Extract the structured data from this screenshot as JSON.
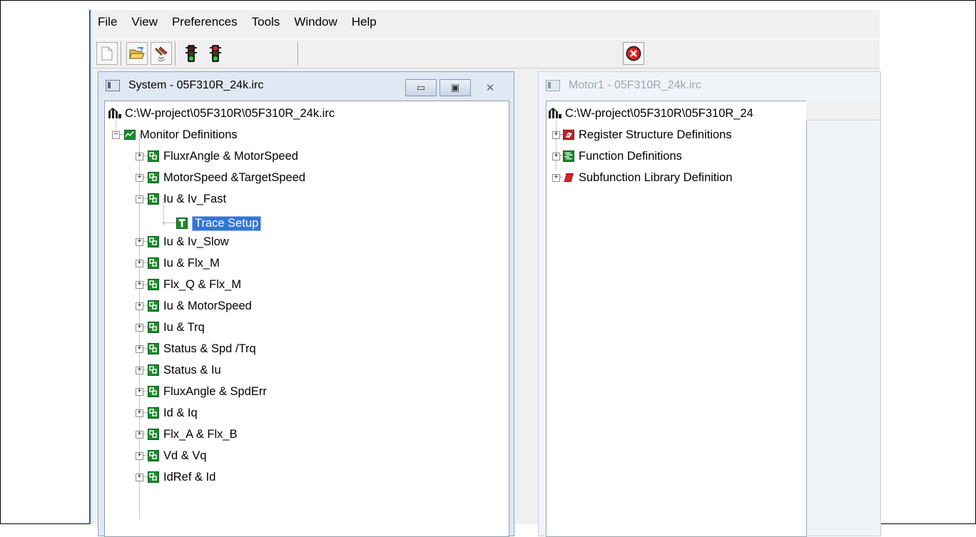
{
  "menu": [
    "File",
    "View",
    "Preferences",
    "Tools",
    "Window",
    "Help"
  ],
  "toolbar": {
    "icons": [
      "new-file-icon",
      "open-folder-icon",
      "connect-tool-icon",
      "traffic-light-green-icon",
      "traffic-light-red-icon",
      "stop-icon"
    ]
  },
  "system_window": {
    "title": "System  - 05F310R_24k.irc",
    "controls": {
      "minimize": "▭",
      "restore": "▣",
      "close": "✕"
    },
    "root_path": "C:\\W-project\\05F310R\\05F310R_24k.irc",
    "monitor_label": "Monitor Definitions",
    "items": [
      "FluxrAngle & MotorSpeed",
      "MotorSpeed &TargetSpeed",
      "Iu & Iv_Fast",
      "Iu & Iv_Slow",
      "Iu & Flx_M",
      "Flx_Q & Flx_M",
      "Iu & MotorSpeed",
      "Iu & Trq",
      "Status & Spd /Trq",
      "Status & Iu",
      "FluxAngle & SpdErr",
      "Id & Iq",
      "Flx_A & Flx_B",
      "Vd & Vq",
      "IdRef & Id"
    ],
    "trace_setup": "Trace Setup"
  },
  "motor_window": {
    "title": "Motor1  - 05F310R_24k.irc",
    "root_path": "C:\\W-project\\05F310R\\05F310R_24",
    "items": [
      "Register Structure Definitions",
      "Function Definitions",
      "Subfunction Library Definition"
    ]
  },
  "colors": {
    "accent": "#1f5fb5",
    "selection": "#3375d7",
    "tree_green": "#1c8a2e",
    "title_active_bg": "#dfe8f3"
  }
}
